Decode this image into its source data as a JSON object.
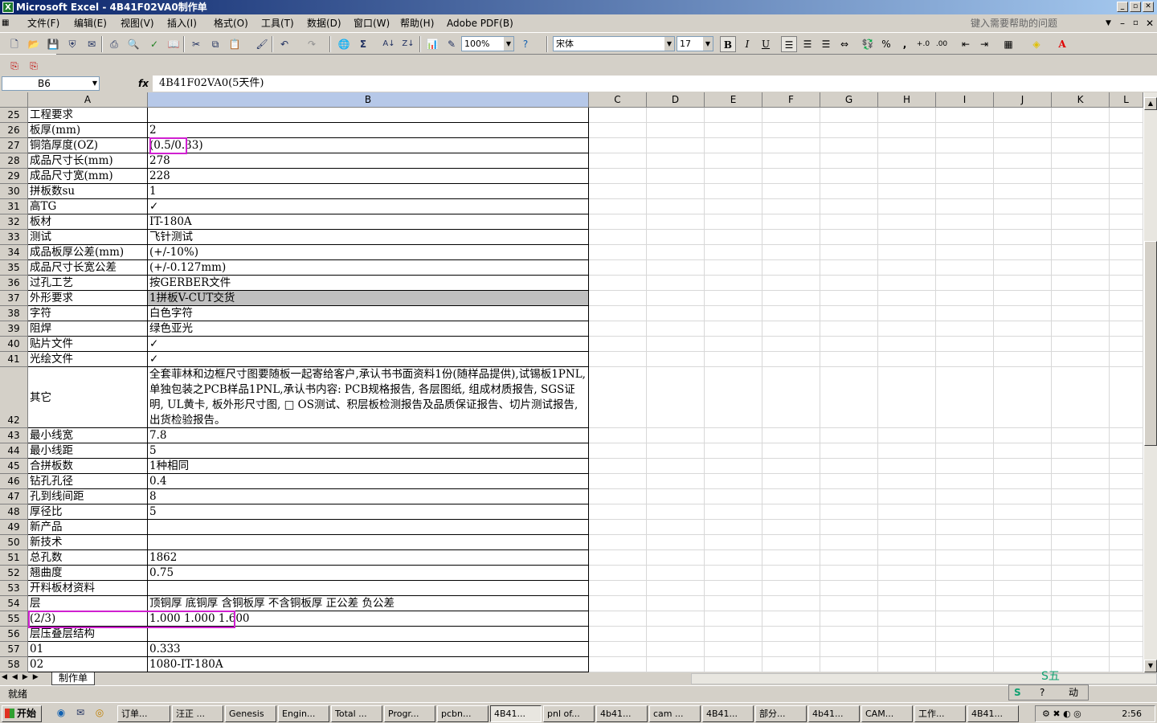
{
  "window": {
    "title": "Microsoft Excel - 4B41F02VA0制作单",
    "controls": [
      "_",
      "▫",
      "✕"
    ]
  },
  "menu": {
    "items": [
      "文件(F)",
      "编辑(E)",
      "视图(V)",
      "插入(I)",
      "格式(O)",
      "工具(T)",
      "数据(D)",
      "窗口(W)",
      "帮助(H)",
      "Adobe PDF(B)"
    ],
    "help_placeholder": "键入需要帮助的问题"
  },
  "toolbar": {
    "zoom": "100%",
    "font": "宋体",
    "font_size": "17",
    "bold": "B",
    "italic": "I",
    "underline": "U",
    "percent": "%",
    "comma": ","
  },
  "formula_bar": {
    "name_box": "B6",
    "fx": "fx",
    "content": "4B41F02VA0(5天件)"
  },
  "columns": [
    "A",
    "B",
    "C",
    "D",
    "E",
    "F",
    "G",
    "H",
    "I",
    "J",
    "K",
    "L"
  ],
  "rows": [
    {
      "num": "25",
      "a": "工程要求",
      "b": ""
    },
    {
      "num": "26",
      "a": "板厚(mm)",
      "b": "2"
    },
    {
      "num": "27",
      "a": "铜箔厚度(OZ)",
      "b": "(0.5/0.33)"
    },
    {
      "num": "28",
      "a": "成品尺寸长(mm)",
      "b": "278"
    },
    {
      "num": "29",
      "a": "成品尺寸宽(mm)",
      "b": "228"
    },
    {
      "num": "30",
      "a": "拼板数su",
      "b": "1"
    },
    {
      "num": "31",
      "a": "高TG",
      "b": "✓"
    },
    {
      "num": "32",
      "a": "板材",
      "b": "IT-180A"
    },
    {
      "num": "33",
      "a": "测试",
      "b": "飞针测试"
    },
    {
      "num": "34",
      "a": "成品板厚公差(mm)",
      "b": "(+/-10%)"
    },
    {
      "num": "35",
      "a": "成品尺寸长宽公差",
      "b": "(+/-0.127mm)"
    },
    {
      "num": "36",
      "a": "过孔工艺",
      "b": "按GERBER文件"
    },
    {
      "num": "37",
      "a": "外形要求",
      "b": "1拼板V-CUT交货"
    },
    {
      "num": "38",
      "a": "字符",
      "b": "白色字符"
    },
    {
      "num": "39",
      "a": "阻焊",
      "b": "绿色亚光"
    },
    {
      "num": "40",
      "a": "贴片文件",
      "b": "✓"
    },
    {
      "num": "41",
      "a": "光绘文件",
      "b": "✓"
    },
    {
      "num": "42",
      "a": "其它",
      "b": "全套菲林和边框尺寸图要随板一起寄给客户,承认书书面资料1份(随样品提供),试锡板1PNL,单独包装之PCB样品1PNL,承认书内容: PCB规格报告, 各层图纸, 组成材质报告, SGS证明, UL黄卡, 板外形尺寸图, □ OS测试、积层板检测报告及品质保证报告、切片测试报告, 出货检验报告。"
    },
    {
      "num": "43",
      "a": "最小线宽",
      "b": "7.8"
    },
    {
      "num": "44",
      "a": "最小线距",
      "b": "5"
    },
    {
      "num": "45",
      "a": "合拼板数",
      "b": "1种相同"
    },
    {
      "num": "46",
      "a": "钻孔孔径",
      "b": "0.4"
    },
    {
      "num": "47",
      "a": "孔到线间距",
      "b": "8"
    },
    {
      "num": "48",
      "a": "厚径比",
      "b": "5"
    },
    {
      "num": "49",
      "a": "新产品",
      "b": ""
    },
    {
      "num": "50",
      "a": "新技术",
      "b": ""
    },
    {
      "num": "51",
      "a": "总孔数",
      "b": "1862"
    },
    {
      "num": "52",
      "a": "翘曲度",
      "b": "0.75"
    },
    {
      "num": "53",
      "a": "开料板材资料",
      "b": ""
    },
    {
      "num": "54",
      "a": "层",
      "b": "顶铜厚 底铜厚 含铜板厚 不含铜板厚 正公差 负公差"
    },
    {
      "num": "55",
      "a": "(2/3)",
      "b": "1.000  1.000    1.600"
    },
    {
      "num": "56",
      "a": "层压叠层结构",
      "b": ""
    },
    {
      "num": "57",
      "a": "01",
      "b": "0.333"
    },
    {
      "num": "58",
      "a": "02",
      "b": "1080-IT-180A"
    }
  ],
  "sheet_tab": "制作单",
  "status": "就绪",
  "ime": "S五",
  "ime_label": "动",
  "taskbar": {
    "start": "开始",
    "tasks": [
      "订单...",
      "汪正 ...",
      "Genesis",
      "Engin...",
      "Total ...",
      "Progr...",
      "pcbn...",
      "4B41...",
      "pnl of...",
      "4b41...",
      "cam ...",
      "4B41...",
      "部分...",
      "4b41...",
      "CAM...",
      "工作...",
      "4B41..."
    ],
    "clock": "2:56"
  }
}
